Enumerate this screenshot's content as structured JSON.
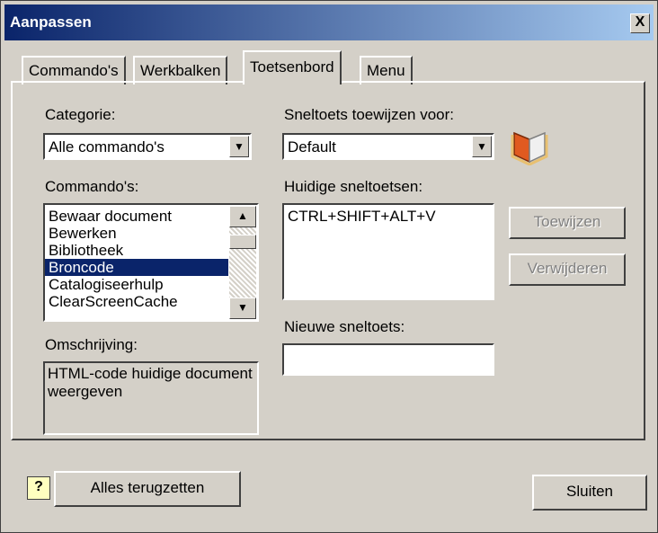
{
  "window": {
    "title": "Aanpassen",
    "close_label": "X"
  },
  "tabs": [
    {
      "label": "Commando's"
    },
    {
      "label": "Werkbalken"
    },
    {
      "label": "Toetsenbord"
    },
    {
      "label": "Menu"
    }
  ],
  "categorie": {
    "label": "Categorie:",
    "value": "Alle commando's"
  },
  "commandos": {
    "label": "Commando's:",
    "items": [
      "Bewaar document",
      "Bewerken",
      "Bibliotheek",
      "Broncode",
      "Catalogiseerhulp",
      "ClearScreenCache"
    ],
    "selected_index": 3
  },
  "omschrijving": {
    "label": "Omschrijving:",
    "text": "HTML-code huidige document weergeven"
  },
  "sneltoets_voor": {
    "label": "Sneltoets toewijzen voor:",
    "value": "Default"
  },
  "huidige": {
    "label": "Huidige sneltoetsen:",
    "items": [
      "CTRL+SHIFT+ALT+V"
    ]
  },
  "nieuwe": {
    "label": "Nieuwe sneltoets:",
    "value": ""
  },
  "buttons": {
    "toewijzen": "Toewijzen",
    "verwijderen": "Verwijderen",
    "alles_terug": "Alles terugzetten",
    "sluiten": "Sluiten",
    "help": "?"
  },
  "colors": {
    "titlebar_start": "#0a246a",
    "titlebar_end": "#a6caf0",
    "selection": "#0a246a",
    "face": "#d4d0c8"
  },
  "icons": {
    "book": "book-icon",
    "help": "help-icon"
  }
}
